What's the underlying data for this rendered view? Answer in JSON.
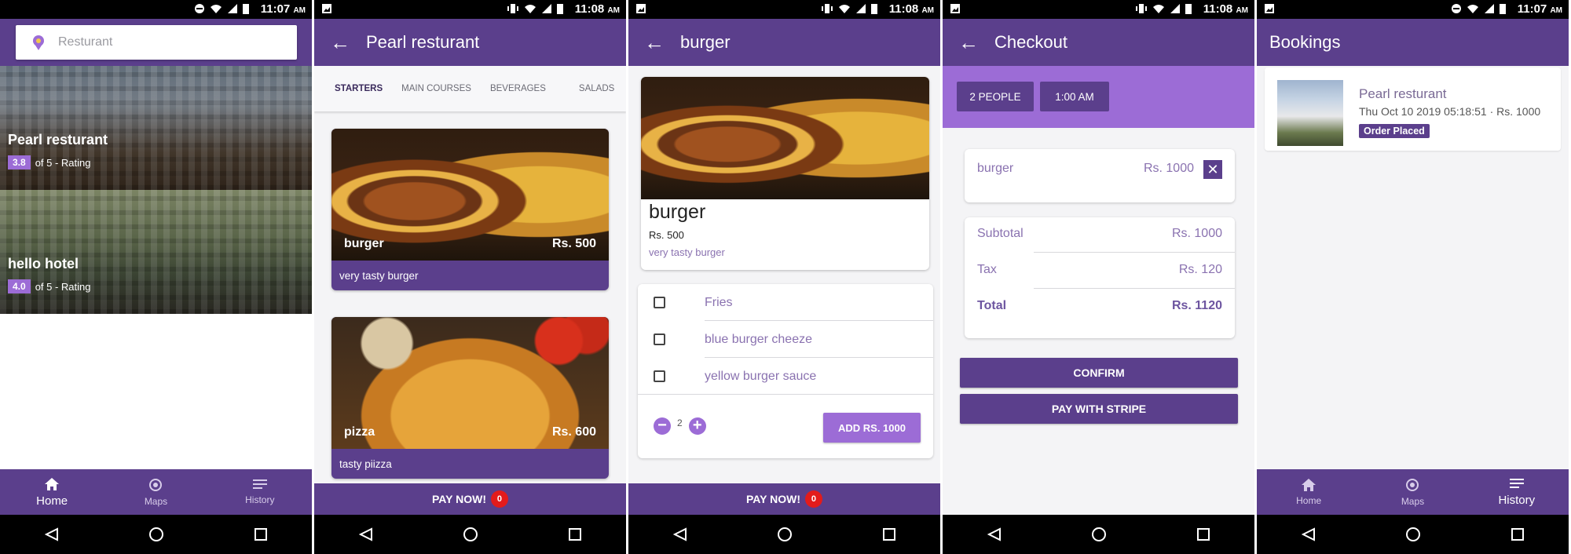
{
  "colors": {
    "primary": "#5b3f8c",
    "accent": "#9c6cd6",
    "badge_red": "#e31b1b"
  },
  "screens": [
    {
      "status_time": "11:07",
      "status_ampm": "AM"
    },
    {
      "status_time": "11:08",
      "status_ampm": "AM"
    },
    {
      "status_time": "11:08",
      "status_ampm": "AM"
    },
    {
      "status_time": "11:08",
      "status_ampm": "AM"
    },
    {
      "status_time": "11:07",
      "status_ampm": "AM"
    }
  ],
  "home": {
    "search_placeholder": "Resturant",
    "hotels": [
      {
        "name": "Pearl resturant",
        "rating": "3.8",
        "rating_suffix": "of 5 - Rating"
      },
      {
        "name": "hello hotel",
        "rating": "4.0",
        "rating_suffix": "of 5 - Rating"
      }
    ]
  },
  "bottom_nav": [
    {
      "label": "Home",
      "icon": "home-icon"
    },
    {
      "label": "Maps",
      "icon": "map-target-icon"
    },
    {
      "label": "History",
      "icon": "history-list-icon"
    }
  ],
  "menu": {
    "title": "Pearl resturant",
    "tabs": [
      "STARTERS",
      "MAIN COURSES",
      "BEVERAGES",
      "SALADS"
    ],
    "items": [
      {
        "name": "burger",
        "price": "Rs. 500",
        "desc": "very tasty burger"
      },
      {
        "name": "pizza",
        "price": "Rs. 600",
        "desc": "tasty piizza"
      }
    ],
    "pay_label": "PAY NOW!",
    "cart_count": "0"
  },
  "detail": {
    "title": "burger",
    "name": "burger",
    "price": "Rs. 500",
    "desc": "very tasty burger",
    "options": [
      "Fries",
      "blue burger cheeze",
      "yellow burger sauce"
    ],
    "minus": "−",
    "plus": "+",
    "quantity": "2",
    "add_label": "ADD RS. 1000",
    "pay_label": "PAY NOW!",
    "cart_count": "0"
  },
  "checkout": {
    "title": "Checkout",
    "people": "2 PEOPLE",
    "time": "1:00 AM",
    "item_name": "burger",
    "item_price": "Rs. 1000",
    "remove": "✕",
    "subtotal_label": "Subtotal",
    "subtotal": "Rs. 1000",
    "tax_label": "Tax",
    "tax": "Rs. 120",
    "total_label": "Total",
    "total": "Rs. 1120",
    "confirm_label": "CONFIRM",
    "stripe_label": "PAY WITH STRIPE"
  },
  "bookings": {
    "title": "Bookings",
    "items": [
      {
        "name": "Pearl resturant",
        "meta": "Thu Oct 10 2019 05:18:51 · Rs. 1000",
        "status": "Order Placed"
      }
    ]
  }
}
